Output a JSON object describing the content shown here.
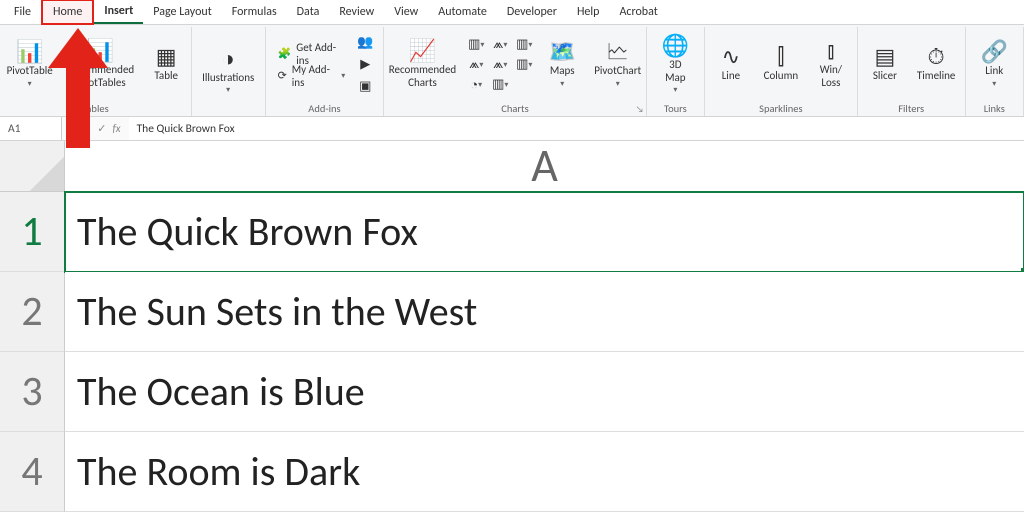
{
  "tabs": {
    "file": "File",
    "home": "Home",
    "insert": "Insert",
    "page_layout": "Page Layout",
    "formulas": "Formulas",
    "data": "Data",
    "review": "Review",
    "view": "View",
    "automate": "Automate",
    "developer": "Developer",
    "help": "Help",
    "acrobat": "Acrobat"
  },
  "ribbon": {
    "groups": {
      "tables": {
        "label": "Tables",
        "pivot_table": "PivotTable",
        "recommended_pt": "Recommended\nPivotTables",
        "table": "Table"
      },
      "illustrations": {
        "label": "Illustrations",
        "button": "Illustrations"
      },
      "addins": {
        "label": "Add-ins",
        "get": "Get Add-ins",
        "my": "My Add-ins"
      },
      "charts": {
        "label": "Charts",
        "recommended": "Recommended\nCharts",
        "maps": "Maps",
        "pivotchart": "PivotChart"
      },
      "tours": {
        "label": "Tours",
        "button": "3D\nMap"
      },
      "sparklines": {
        "label": "Sparklines",
        "line": "Line",
        "column": "Column",
        "winloss": "Win/\nLoss"
      },
      "filters": {
        "label": "Filters",
        "slicer": "Slicer",
        "timeline": "Timeline"
      },
      "links": {
        "label": "Links",
        "button": "Link"
      }
    }
  },
  "formula_bar": {
    "cell_ref": "A1",
    "fx": "fx",
    "value": "The Quick Brown Fox"
  },
  "sheet": {
    "column_header": "A",
    "rows": [
      {
        "num": "1",
        "value": "The Quick Brown Fox"
      },
      {
        "num": "2",
        "value": "The Sun Sets in the West"
      },
      {
        "num": "3",
        "value": "The Ocean is Blue"
      },
      {
        "num": "4",
        "value": "The Room is Dark"
      }
    ]
  },
  "annotation": {
    "highlight_tab": "Home"
  }
}
